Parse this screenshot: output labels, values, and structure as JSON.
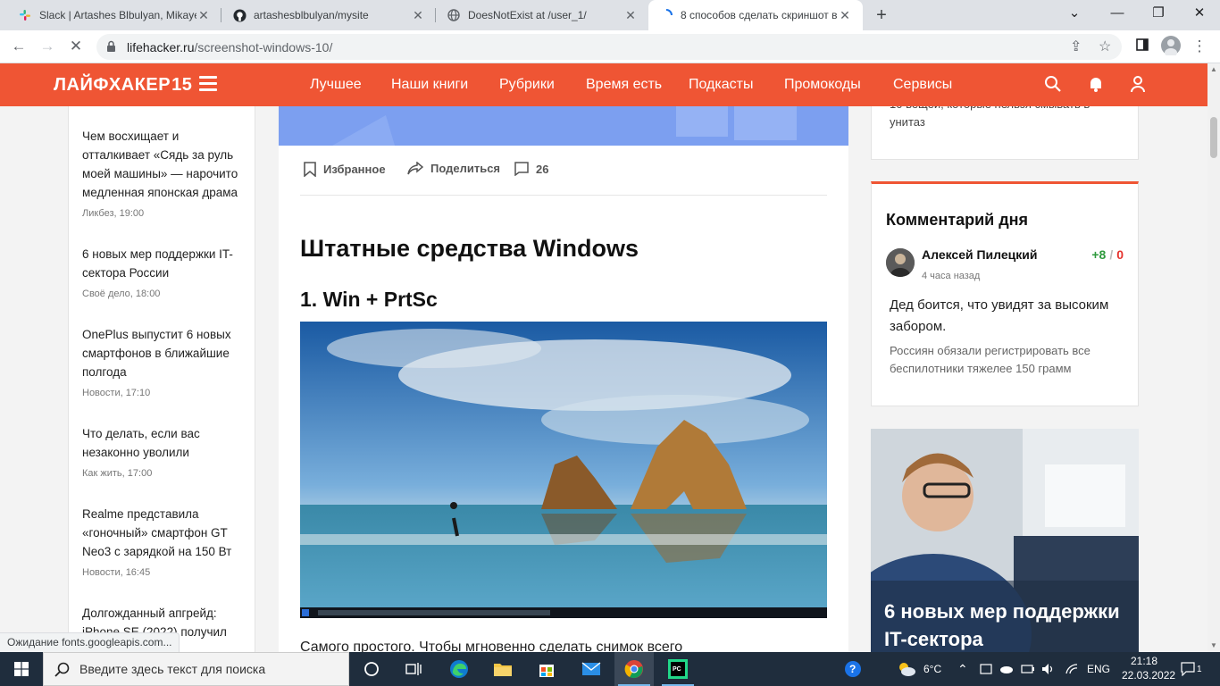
{
  "browser": {
    "tabs": [
      {
        "title": "Slack | Artashes Blbulyan, Mikaye",
        "icon": "slack-icon"
      },
      {
        "title": "artashesblbulyan/mysite",
        "icon": "github-icon"
      },
      {
        "title": "DoesNotExist at /user_1/",
        "icon": "globe-icon"
      },
      {
        "title": "8 способов сделать скриншот в",
        "icon": "loading-spinner-icon"
      }
    ],
    "url_host": "lifehacker.ru",
    "url_path": "/screenshot-windows-10/",
    "status_text": "Ожидание fonts.googleapis.com..."
  },
  "site": {
    "logo": "ЛАЙФХАКЕР",
    "logo_badge": "15",
    "nav": [
      "Лучшее",
      "Наши книги",
      "Рубрики",
      "Время есть",
      "Подкасты",
      "Промокоды",
      "Сервисы"
    ],
    "accent": "#ef5534"
  },
  "sidebar": {
    "news": [
      {
        "title": "Чем восхищает и отталкивает «Сядь за руль моей машины» — нарочито медленная японская драма",
        "meta": "Ликбез, 19:00"
      },
      {
        "title": "6 новых мер поддержки IT-сектора России",
        "meta": "Своё дело, 18:00"
      },
      {
        "title": "OnePlus выпустит 6 новых смартфонов в ближайшие полгода",
        "meta": "Новости, 17:10"
      },
      {
        "title": "Что делать, если вас незаконно уволили",
        "meta": "Как жить, 17:00"
      },
      {
        "title": "Realme представила «гоночный» смартфон GT Neo3 с зарядкой на 150 Вт",
        "meta": "Новости, 16:45"
      },
      {
        "title": "Долгожданный апгрейд: iPhone SE (2022) получил",
        "meta": ""
      }
    ]
  },
  "article": {
    "actions": {
      "favorite": "Избранное",
      "share": "Поделиться",
      "comments": "26"
    },
    "h2": "Штатные средства Windows",
    "h3": "1. Win + PrtSc",
    "paragraph": "Самого простого. Чтобы мгновенно сделать снимок всего"
  },
  "right": {
    "top_card_text": "10 вещей, которые нельзя смывать в унитаз",
    "comment_of_day": {
      "heading": "Комментарий дня",
      "author": "Алексей Пилецкий",
      "time": "4 часа назад",
      "votes_plus": "+8",
      "votes_sep": "/",
      "votes_minus": "0",
      "text": "Дед боится, что увидят за высоким забором.",
      "link": "Россиян обязали регистрировать все беспилотники тяжелее 150 грамм"
    },
    "promo_title": "6 новых мер поддержки IT-сектора"
  },
  "taskbar": {
    "search_placeholder": "Введите здесь текст для поиска",
    "weather": "6°C",
    "language": "ENG",
    "time": "21:18",
    "date": "22.03.2022",
    "notifications": "1"
  }
}
